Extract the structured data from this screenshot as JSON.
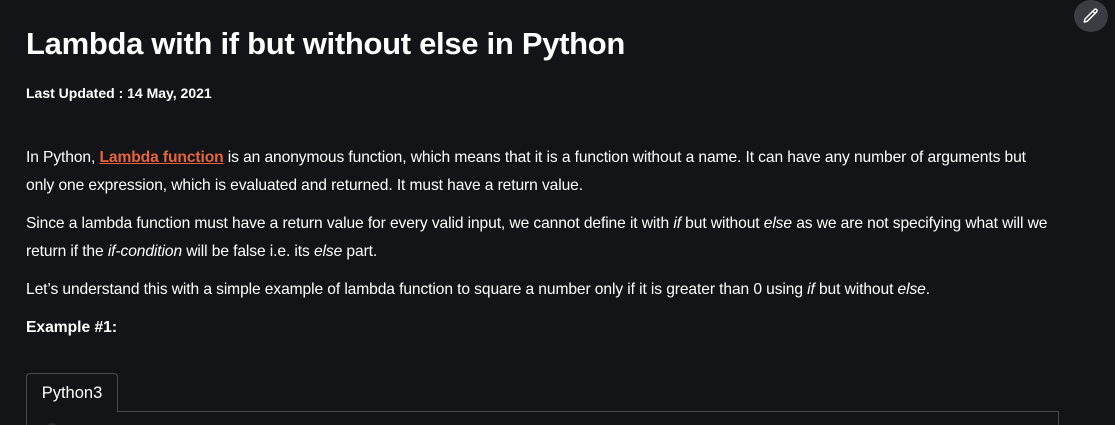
{
  "article": {
    "title": "Lambda with if but without else in Python",
    "last_updated": "Last Updated : 14 May, 2021",
    "p1": {
      "before": "In Python, ",
      "link": "Lambda function",
      "after": " is an anonymous function, which means that it is a function without a name. It can have any number of arguments but only one expression, which is evaluated and returned. It must have a return value."
    },
    "p2": {
      "t1": "Since a lambda function must have a return value for every valid input, we cannot define it with ",
      "e1": "if",
      "t2": " but without ",
      "e2": "else",
      "t3": " as we are not specifying what will we return if the ",
      "e3": "if-condition",
      "t4": " will be false i.e. its ",
      "e4": "else",
      "t5": " part."
    },
    "p3": {
      "t1": "Let’s understand this with a simple example of lambda function to square a number only if it is greater than 0 using ",
      "e1": "if",
      "t2": " but without ",
      "e2": "else",
      "t3": "."
    },
    "example_heading": "Example #1:"
  },
  "code": {
    "tabs": [
      "Python3"
    ]
  },
  "icons": {
    "edit": "pencil-icon"
  },
  "colors": {
    "background": "#131417",
    "link": "#e9643b",
    "text": "#ffffff"
  }
}
